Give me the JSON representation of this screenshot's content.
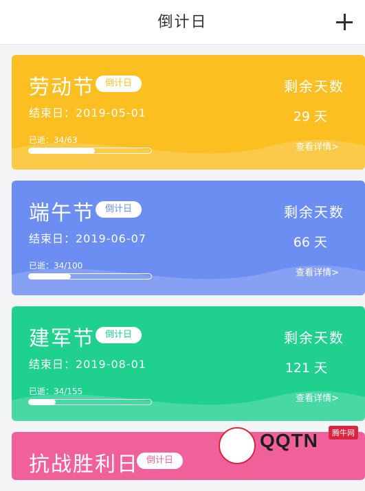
{
  "header": {
    "title": "倒计日",
    "add_icon": "plus-icon"
  },
  "cards": [
    {
      "name": "劳动节",
      "tag": "倒计日",
      "end_date": "结束日：2019-05-01",
      "elapsed": "已逝：34/63",
      "progress": 0.54,
      "remaining_label": "剩余天数",
      "remaining_days": "29 天",
      "detail": "查看详情>",
      "color": "#fbbf22"
    },
    {
      "name": "端午节",
      "tag": "倒计日",
      "end_date": "结束日：2019-06-07",
      "elapsed": "已逝：34/100",
      "progress": 0.34,
      "remaining_label": "剩余天数",
      "remaining_days": "66 天",
      "detail": "查看详情>",
      "color": "#6c8df2"
    },
    {
      "name": "建军节",
      "tag": "倒计日",
      "end_date": "结束日：2019-08-01",
      "elapsed": "已逝：34/155",
      "progress": 0.22,
      "remaining_label": "剩余天数",
      "remaining_days": "121 天",
      "detail": "查看详情>",
      "color": "#1fd08f"
    },
    {
      "name": "抗战胜利日",
      "tag": "倒计日",
      "color": "#f0609a"
    }
  ],
  "watermark": {
    "text": "QQTN",
    "badge": "腾牛网"
  }
}
